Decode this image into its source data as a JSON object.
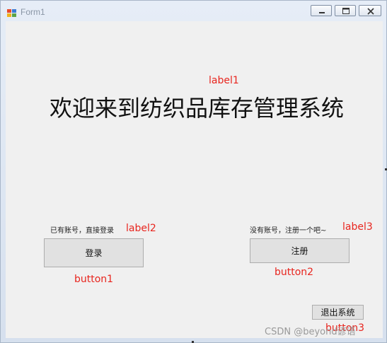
{
  "window": {
    "title": "Form1"
  },
  "labels": {
    "label1_name": "label1",
    "title_text": "欢迎来到纺织品库存管理系统",
    "label2_text": "已有账号，直接登录",
    "label2_name": "label2",
    "label3_text": "没有账号，注册一个吧~",
    "label3_name": "label3"
  },
  "buttons": {
    "button1_text": "登录",
    "button1_name": "button1",
    "button2_text": "注册",
    "button2_name": "button2",
    "button3_text": "退出系统",
    "button3_name": "button3"
  },
  "watermark": "CSDN @beyond谚语"
}
